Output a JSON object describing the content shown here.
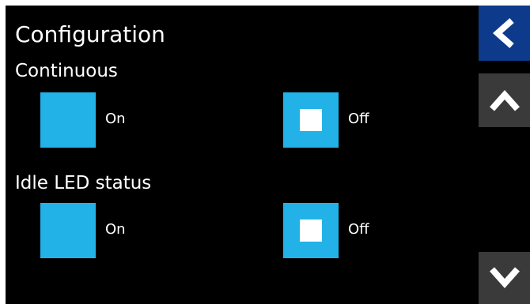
{
  "title": "Configuration",
  "sections": [
    {
      "label": "Continuous",
      "options": [
        {
          "label": "On",
          "checked": false
        },
        {
          "label": "Off",
          "checked": true
        }
      ]
    },
    {
      "label": "Idle LED status",
      "options": [
        {
          "label": "On",
          "checked": false
        },
        {
          "label": "Off",
          "checked": true
        }
      ]
    }
  ],
  "nav": {
    "back_icon": "chevron-left-icon",
    "up_icon": "chevron-up-icon",
    "down_icon": "chevron-down-icon"
  },
  "colors": {
    "background": "#000000",
    "option_box": "#22b2e8",
    "back_button": "#0d3a8a",
    "scroll_button": "#3a3a3a",
    "text": "#ffffff"
  }
}
